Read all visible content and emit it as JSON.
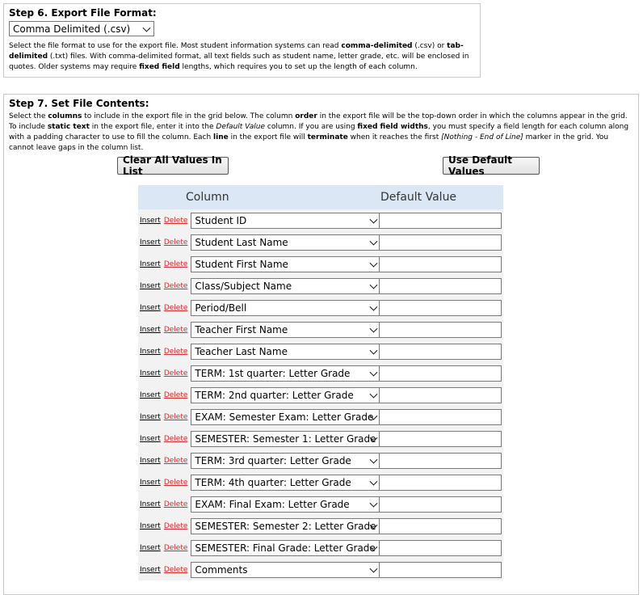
{
  "step6": {
    "title": "Step 6. Export File Format:",
    "selected_format": "Comma Delimited (.csv)",
    "description": {
      "t1": "Select the file format to use for the export file. Most student information systems can read ",
      "b1": "comma-delimited",
      "t2": " (.csv) or ",
      "b2": "tab-delimited",
      "t3": " (.txt) files. With comma-delimited format, all text fields such as student name, letter grade, etc. will be enclosed in quotes. Older systems may require ",
      "b3": "fixed field",
      "t4": " lengths, which requires you to set up the length of each column."
    }
  },
  "step7": {
    "title": "Step 7. Set File Contents:",
    "description": {
      "t1": "Select the ",
      "b1": "columns",
      "t2": " to include in the export file in the grid below. The column ",
      "b2": "order",
      "t3": " in the export file will be the top-down order in which the columns appear in the grid. To include ",
      "b3": "static text",
      "t4": " in the export file, enter it into the ",
      "i1": "Default Value",
      "t5": " column. If you are using ",
      "b4": "fixed field widths",
      "t6": ", you must specify a field length for each column along with a padding character to use to fill the column. Each ",
      "b5": "line",
      "t7": " in the export file will ",
      "b6": "terminate",
      "t8": " when it reaches the first ",
      "i2": "[Nothing - End of Line]",
      "t9": " marker in the grid. You cannot leave gaps in the column list."
    },
    "clear_button": "Clear All Values In List",
    "default_button": "Use Default Values",
    "grid": {
      "col_header": "Column",
      "default_header": "Default Value",
      "insert_label": "Insert",
      "delete_label": "Delete",
      "rows": [
        "Student ID",
        "Student Last Name",
        "Student First Name",
        "Class/Subject Name",
        "Period/Bell",
        "Teacher First Name",
        "Teacher Last Name",
        "TERM: 1st quarter: Letter Grade",
        "TERM: 2nd quarter: Letter Grade",
        "EXAM: Semester Exam: Letter Grade",
        "SEMESTER: Semester 1: Letter Grade",
        "TERM: 3rd quarter: Letter Grade",
        "TERM: 4th quarter: Letter Grade",
        "EXAM: Final Exam: Letter Grade",
        "SEMESTER: Semester 2: Letter Grade",
        "SEMESTER: Final Grade: Letter Grade",
        "Comments"
      ]
    }
  },
  "colors": {
    "accent_header": "#dbe7f5",
    "delete_link": "#d03030",
    "row_bg": "#f2f2f2"
  }
}
